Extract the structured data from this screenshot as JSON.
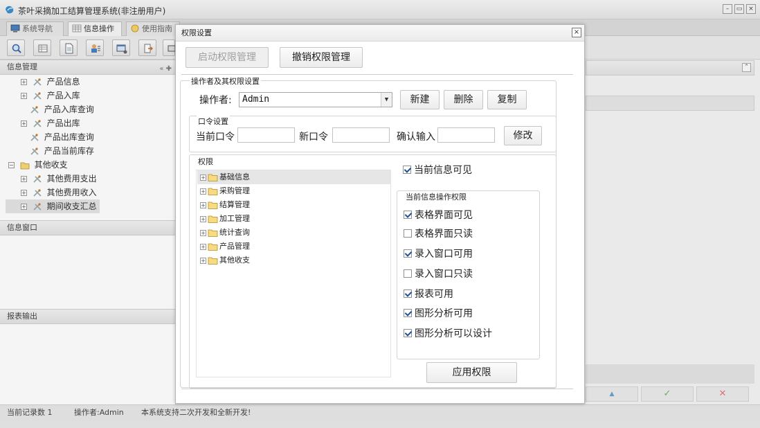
{
  "window": {
    "title": "茶叶采摘加工结算管理系统(非注册用户)",
    "ctrl_min": "–",
    "ctrl_max": "▭",
    "ctrl_close": "×"
  },
  "tabs": [
    {
      "label": "系统导航"
    },
    {
      "label": "信息操作"
    },
    {
      "label": "使用指南"
    }
  ],
  "left_panel": {
    "header": "信息管理",
    "header_tools": "« ✚",
    "items": [
      {
        "label": "产品信息"
      },
      {
        "label": "产品入库"
      },
      {
        "label": "产品入库查询"
      },
      {
        "label": "产品出库"
      },
      {
        "label": "产品出库查询"
      },
      {
        "label": "产品当前库存"
      },
      {
        "label": "其他收支"
      },
      {
        "label": "其他费用支出"
      },
      {
        "label": "其他费用收入"
      },
      {
        "label": "期间收支汇总"
      }
    ],
    "section2": "信息窗口",
    "section3": "报表输出"
  },
  "right_area": {
    "collapse": "⌃",
    "btn_up": "▲",
    "btn_ok": "✓",
    "btn_cancel": "✕"
  },
  "status": {
    "records": "当前记录数 1",
    "operator": "操作者:Admin",
    "note": "本系统支持二次开发和全新开发!"
  },
  "dialog": {
    "title": "权限设置",
    "close": "×",
    "btn_enable": "启动权限管理",
    "btn_revoke": "撤销权限管理",
    "section_operator": "操作者及其权限设置",
    "operator_label": "操作者:",
    "operator_value": "Admin",
    "btn_new": "新建",
    "btn_delete": "删除",
    "btn_copy": "复制",
    "password_section": "口令设置",
    "current_pwd_label": "当前口令",
    "new_pwd_label": "新口令",
    "confirm_label": "确认输入",
    "btn_modify": "修改",
    "perm_section": "权限",
    "perm_tree": [
      {
        "label": "基础信息"
      },
      {
        "label": "采购管理"
      },
      {
        "label": "结算管理"
      },
      {
        "label": "加工管理"
      },
      {
        "label": "统计查询"
      },
      {
        "label": "产品管理"
      },
      {
        "label": "其他收支"
      }
    ],
    "visible_label": "当前信息可见",
    "visible_checked": true,
    "ops_section": "当前信息操作权限",
    "ops": [
      {
        "label": "表格界面可见",
        "checked": true
      },
      {
        "label": "表格界面只读",
        "checked": false
      },
      {
        "label": "录入窗口可用",
        "checked": true
      },
      {
        "label": "录入窗口只读",
        "checked": false
      },
      {
        "label": "报表可用",
        "checked": true
      },
      {
        "label": "图形分析可用",
        "checked": true
      },
      {
        "label": "图形分析可以设计",
        "checked": true
      }
    ],
    "btn_apply": "应用权限"
  }
}
